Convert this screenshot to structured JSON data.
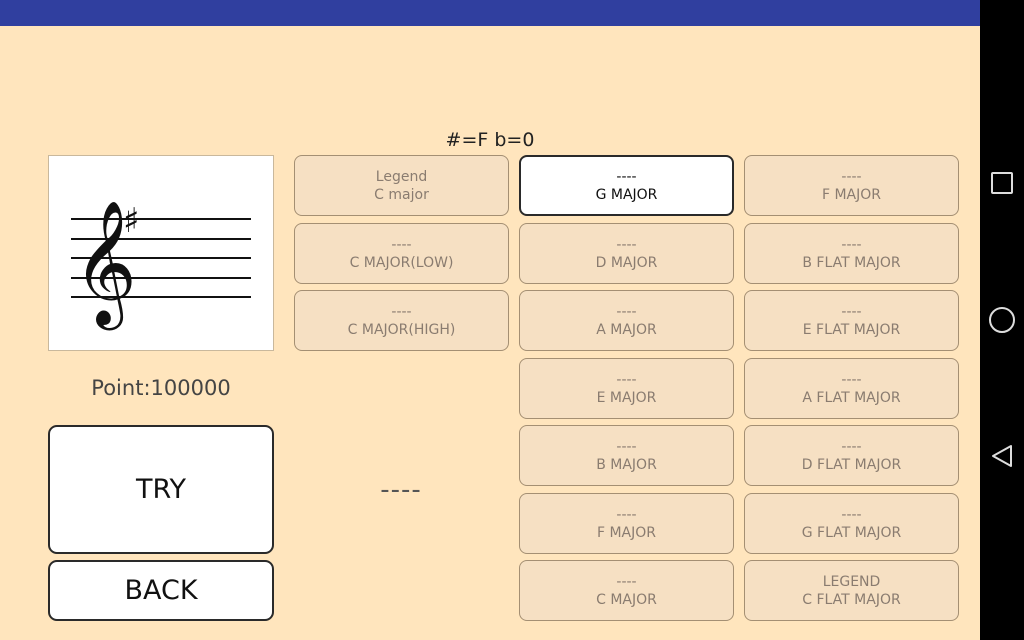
{
  "key_signature": "#=F  b=0",
  "status": {
    "point": "Point:100000"
  },
  "actions": {
    "try_label": "TRY",
    "back_label": "BACK"
  },
  "answer": "----",
  "colors": {
    "status_bar": "#303f9f",
    "background": "#ffe5bd",
    "key_button": "#f6e0c3",
    "key_button_border": "#a48f73"
  },
  "keys": {
    "col1": [
      {
        "top": "Legend",
        "bottom": "C major"
      },
      {
        "top": "----",
        "bottom": "C MAJOR(LOW)"
      },
      {
        "top": "----",
        "bottom": "C MAJOR(HIGH)"
      }
    ],
    "col2": [
      {
        "top": "----",
        "bottom": "G MAJOR"
      },
      {
        "top": "----",
        "bottom": "D MAJOR"
      },
      {
        "top": "----",
        "bottom": "A MAJOR"
      },
      {
        "top": "----",
        "bottom": "E MAJOR"
      },
      {
        "top": "----",
        "bottom": "B MAJOR"
      },
      {
        "top": "----",
        "bottom": "F MAJOR"
      },
      {
        "top": "----",
        "bottom": "C MAJOR"
      }
    ],
    "col3": [
      {
        "top": "----",
        "bottom": "F MAJOR"
      },
      {
        "top": "----",
        "bottom": "B FLAT MAJOR"
      },
      {
        "top": "----",
        "bottom": "E FLAT MAJOR"
      },
      {
        "top": "----",
        "bottom": "A FLAT MAJOR"
      },
      {
        "top": "----",
        "bottom": "D FLAT MAJOR"
      },
      {
        "top": "----",
        "bottom": "G FLAT MAJOR"
      },
      {
        "top": "LEGEND",
        "bottom": "C FLAT MAJOR"
      }
    ]
  },
  "nav": {
    "recents_icon": "square-icon",
    "home_icon": "circle-icon",
    "back_icon": "triangle-back-icon"
  }
}
